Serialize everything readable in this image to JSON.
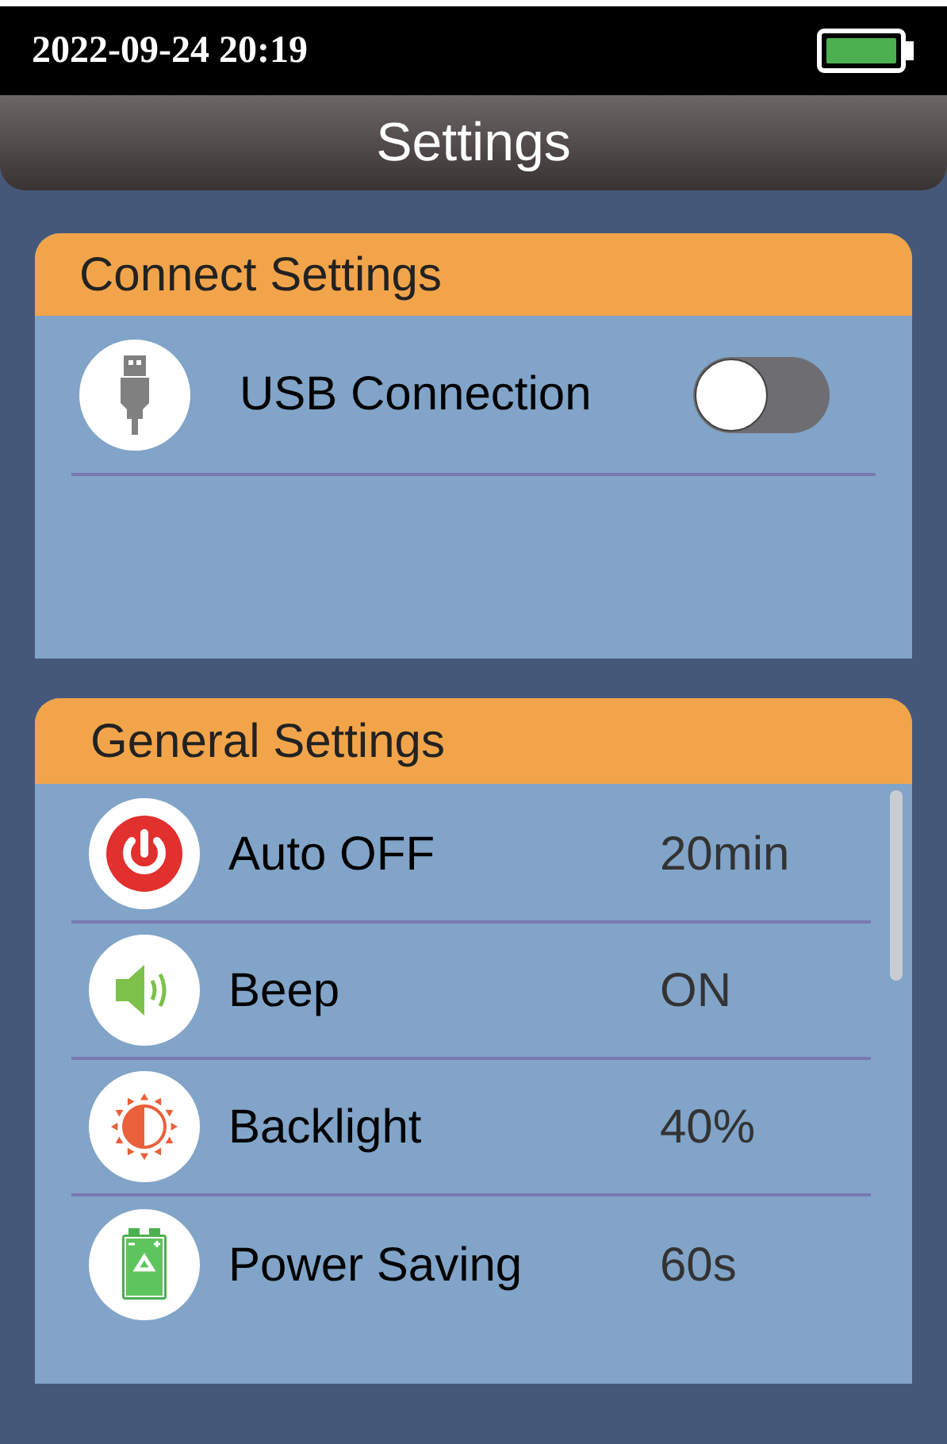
{
  "status_bar": {
    "datetime": "2022-09-24 20:19"
  },
  "header": {
    "title": "Settings"
  },
  "connect_settings": {
    "title": "Connect Settings",
    "items": [
      {
        "label": "USB Connection",
        "on": false
      }
    ]
  },
  "general_settings": {
    "title": "General Settings",
    "items": [
      {
        "label": "Auto OFF",
        "value": "20min"
      },
      {
        "label": "Beep",
        "value": "ON"
      },
      {
        "label": "Backlight",
        "value": "40%"
      },
      {
        "label": "Power Saving",
        "value": "60s"
      }
    ]
  }
}
